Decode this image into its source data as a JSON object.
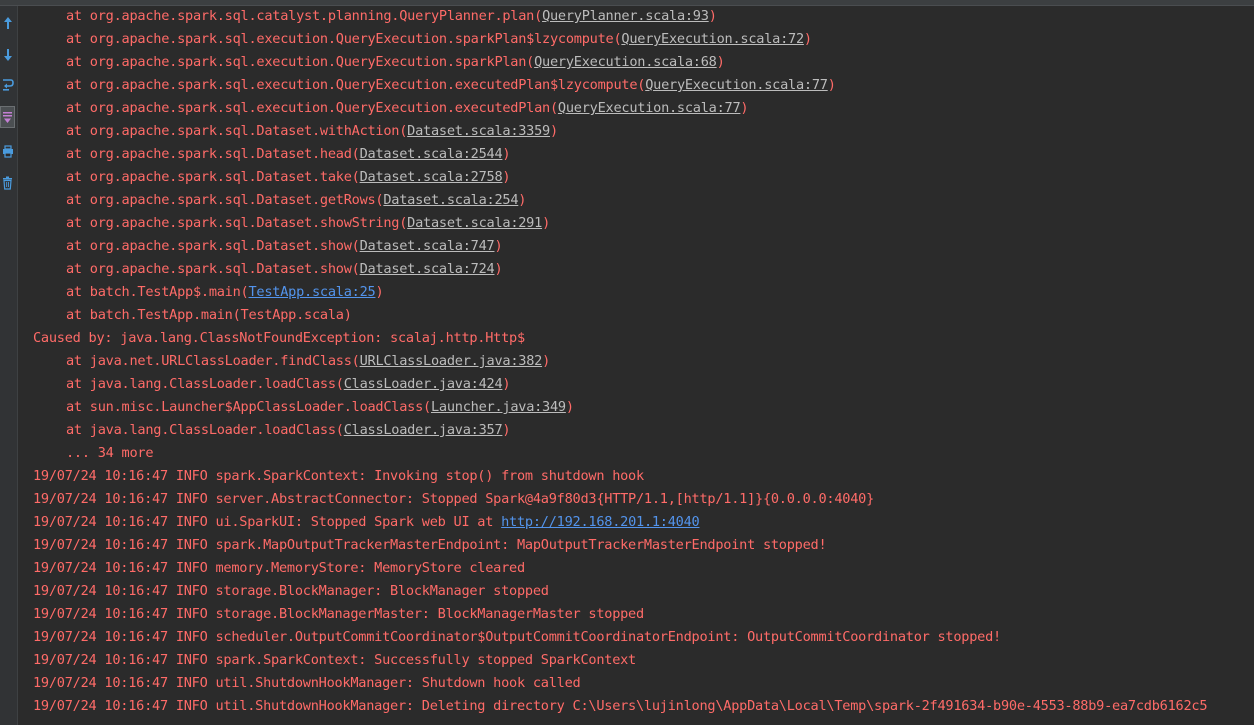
{
  "colors": {
    "background": "#2b2b2b",
    "error_text": "#ff6b68",
    "file_link": "#bcbcbc",
    "url_link": "#5394ec"
  },
  "gutter": {
    "icons": [
      {
        "name": "up-stack-trace-icon"
      },
      {
        "name": "down-stack-trace-icon"
      },
      {
        "name": "soft-wrap-icon"
      },
      {
        "name": "scroll-to-end-icon"
      },
      {
        "name": "print-icon"
      },
      {
        "name": "clear-all-icon"
      }
    ]
  },
  "console": {
    "lines": [
      {
        "indent": true,
        "parts": [
          {
            "text": "at org.apache.spark.sql.catalyst.planning.QueryPlanner.plan("
          },
          {
            "text": "QueryPlanner.scala:93",
            "link": true
          },
          {
            "text": ")"
          }
        ]
      },
      {
        "indent": true,
        "parts": [
          {
            "text": "at org.apache.spark.sql.execution.QueryExecution.sparkPlan$lzycompute("
          },
          {
            "text": "QueryExecution.scala:72",
            "link": true
          },
          {
            "text": ")"
          }
        ]
      },
      {
        "indent": true,
        "parts": [
          {
            "text": "at org.apache.spark.sql.execution.QueryExecution.sparkPlan("
          },
          {
            "text": "QueryExecution.scala:68",
            "link": true
          },
          {
            "text": ")"
          }
        ]
      },
      {
        "indent": true,
        "parts": [
          {
            "text": "at org.apache.spark.sql.execution.QueryExecution.executedPlan$lzycompute("
          },
          {
            "text": "QueryExecution.scala:77",
            "link": true
          },
          {
            "text": ")"
          }
        ]
      },
      {
        "indent": true,
        "parts": [
          {
            "text": "at org.apache.spark.sql.execution.QueryExecution.executedPlan("
          },
          {
            "text": "QueryExecution.scala:77",
            "link": true
          },
          {
            "text": ")"
          }
        ]
      },
      {
        "indent": true,
        "parts": [
          {
            "text": "at org.apache.spark.sql.Dataset.withAction("
          },
          {
            "text": "Dataset.scala:3359",
            "link": true
          },
          {
            "text": ")"
          }
        ]
      },
      {
        "indent": true,
        "parts": [
          {
            "text": "at org.apache.spark.sql.Dataset.head("
          },
          {
            "text": "Dataset.scala:2544",
            "link": true
          },
          {
            "text": ")"
          }
        ]
      },
      {
        "indent": true,
        "parts": [
          {
            "text": "at org.apache.spark.sql.Dataset.take("
          },
          {
            "text": "Dataset.scala:2758",
            "link": true
          },
          {
            "text": ")"
          }
        ]
      },
      {
        "indent": true,
        "parts": [
          {
            "text": "at org.apache.spark.sql.Dataset.getRows("
          },
          {
            "text": "Dataset.scala:254",
            "link": true
          },
          {
            "text": ")"
          }
        ]
      },
      {
        "indent": true,
        "parts": [
          {
            "text": "at org.apache.spark.sql.Dataset.showString("
          },
          {
            "text": "Dataset.scala:291",
            "link": true
          },
          {
            "text": ")"
          }
        ]
      },
      {
        "indent": true,
        "parts": [
          {
            "text": "at org.apache.spark.sql.Dataset.show("
          },
          {
            "text": "Dataset.scala:747",
            "link": true
          },
          {
            "text": ")"
          }
        ]
      },
      {
        "indent": true,
        "parts": [
          {
            "text": "at org.apache.spark.sql.Dataset.show("
          },
          {
            "text": "Dataset.scala:724",
            "link": true
          },
          {
            "text": ")"
          }
        ]
      },
      {
        "indent": true,
        "parts": [
          {
            "text": "at batch.TestApp$.main("
          },
          {
            "text": "TestApp.scala:25",
            "link": true,
            "blue": true
          },
          {
            "text": ")"
          }
        ]
      },
      {
        "indent": true,
        "parts": [
          {
            "text": "at batch.TestApp.main(TestApp.scala)"
          }
        ]
      },
      {
        "indent": false,
        "parts": [
          {
            "text": "Caused by: java.lang.ClassNotFoundException: scalaj.http.Http$"
          }
        ]
      },
      {
        "indent": true,
        "parts": [
          {
            "text": "at java.net.URLClassLoader.findClass("
          },
          {
            "text": "URLClassLoader.java:382",
            "link": true
          },
          {
            "text": ")"
          }
        ]
      },
      {
        "indent": true,
        "parts": [
          {
            "text": "at java.lang.ClassLoader.loadClass("
          },
          {
            "text": "ClassLoader.java:424",
            "link": true
          },
          {
            "text": ")"
          }
        ]
      },
      {
        "indent": true,
        "parts": [
          {
            "text": "at sun.misc.Launcher$AppClassLoader.loadClass("
          },
          {
            "text": "Launcher.java:349",
            "link": true
          },
          {
            "text": ")"
          }
        ]
      },
      {
        "indent": true,
        "parts": [
          {
            "text": "at java.lang.ClassLoader.loadClass("
          },
          {
            "text": "ClassLoader.java:357",
            "link": true
          },
          {
            "text": ")"
          }
        ]
      },
      {
        "indent": true,
        "parts": [
          {
            "text": "... 34 more"
          }
        ]
      },
      {
        "indent": false,
        "parts": [
          {
            "text": "19/07/24 10:16:47 INFO spark.SparkContext: Invoking stop() from shutdown hook"
          }
        ]
      },
      {
        "indent": false,
        "parts": [
          {
            "text": "19/07/24 10:16:47 INFO server.AbstractConnector: Stopped Spark@4a9f80d3{HTTP/1.1,[http/1.1]}{0.0.0.0:4040}"
          }
        ]
      },
      {
        "indent": false,
        "parts": [
          {
            "text": "19/07/24 10:16:47 INFO ui.SparkUI: Stopped Spark web UI at "
          },
          {
            "text": "http://192.168.201.1:4040",
            "link": true,
            "blue": true
          }
        ]
      },
      {
        "indent": false,
        "parts": [
          {
            "text": "19/07/24 10:16:47 INFO spark.MapOutputTrackerMasterEndpoint: MapOutputTrackerMasterEndpoint stopped!"
          }
        ]
      },
      {
        "indent": false,
        "parts": [
          {
            "text": "19/07/24 10:16:47 INFO memory.MemoryStore: MemoryStore cleared"
          }
        ]
      },
      {
        "indent": false,
        "parts": [
          {
            "text": "19/07/24 10:16:47 INFO storage.BlockManager: BlockManager stopped"
          }
        ]
      },
      {
        "indent": false,
        "parts": [
          {
            "text": "19/07/24 10:16:47 INFO storage.BlockManagerMaster: BlockManagerMaster stopped"
          }
        ]
      },
      {
        "indent": false,
        "parts": [
          {
            "text": "19/07/24 10:16:47 INFO scheduler.OutputCommitCoordinator$OutputCommitCoordinatorEndpoint: OutputCommitCoordinator stopped!"
          }
        ]
      },
      {
        "indent": false,
        "parts": [
          {
            "text": "19/07/24 10:16:47 INFO spark.SparkContext: Successfully stopped SparkContext"
          }
        ]
      },
      {
        "indent": false,
        "parts": [
          {
            "text": "19/07/24 10:16:47 INFO util.ShutdownHookManager: Shutdown hook called"
          }
        ]
      },
      {
        "indent": false,
        "parts": [
          {
            "text": "19/07/24 10:16:47 INFO util.ShutdownHookManager: Deleting directory C:\\Users\\lujinlong\\AppData\\Local\\Temp\\spark-2f491634-b90e-4553-88b9-ea7cdb6162c5"
          }
        ]
      }
    ]
  }
}
